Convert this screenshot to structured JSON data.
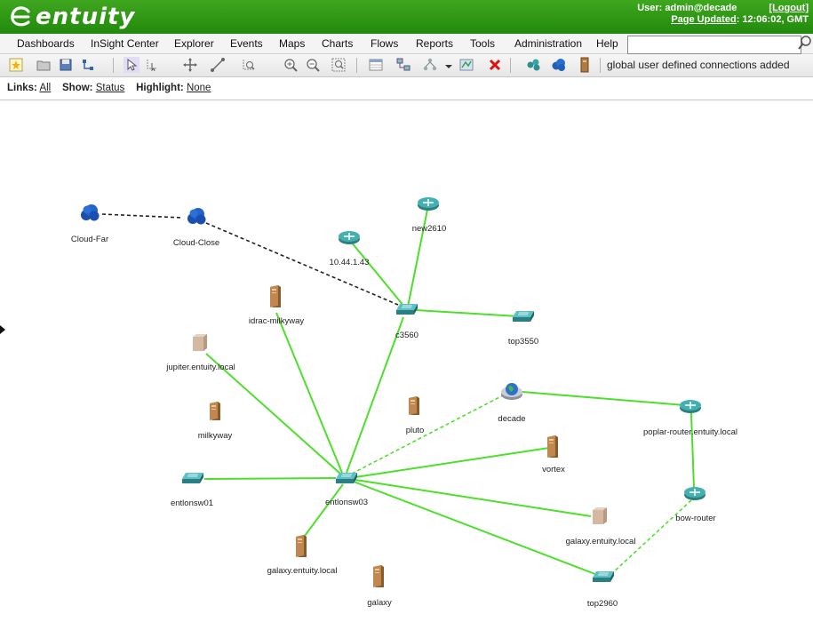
{
  "header": {
    "logo_text": "entuity",
    "user_label": "User: admin@decade",
    "logout_label": "[Logout]",
    "page_updated_link": "Page Updated",
    "page_updated_time": ": 12:06:02, GMT"
  },
  "menu": {
    "items": [
      "Dashboards",
      "InSight Center",
      "Explorer",
      "Events",
      "Maps",
      "Charts",
      "Flows",
      "Reports",
      "Tools",
      "Administration",
      "Help"
    ],
    "search_value": ""
  },
  "toolbar": {
    "status_text": "global user defined connections added",
    "icons": [
      "favorite-icon",
      "open-folder-icon",
      "save-icon",
      "layout-icon",
      "select-pointer-icon",
      "lasso-select-icon",
      "pan-icon",
      "connect-icon",
      "zoom-area-icon",
      "zoom-in-icon",
      "zoom-out-icon",
      "zoom-fit-icon",
      "table-view-icon",
      "network-devices-icon",
      "tree-layout-icon",
      "dropdown-arrow-icon",
      "map-icon",
      "delete-icon",
      "cloud-group-icon",
      "cloud-icon",
      "server-icon"
    ]
  },
  "filters": {
    "links_label": "Links:",
    "links_value": "All",
    "show_label": "Show:",
    "show_value": "Status",
    "highlight_label": "Highlight:",
    "highlight_value": "None"
  },
  "colors": {
    "header_green": "#2a9614",
    "link_up": "#4ce02a",
    "link_user_defined": "#222222",
    "router_teal": "#2e8f8f"
  },
  "map": {
    "nodes": [
      {
        "id": "cloud-far",
        "label": "Cloud-Far",
        "kind": "cloud"
      },
      {
        "id": "cloud-close",
        "label": "Cloud-Close",
        "kind": "cloud"
      },
      {
        "id": "new2610",
        "label": "new2610",
        "kind": "router"
      },
      {
        "id": "ip10",
        "label": "10.44.1.43",
        "kind": "router"
      },
      {
        "id": "c3560",
        "label": "c3560",
        "kind": "switch"
      },
      {
        "id": "top3550",
        "label": "top3550",
        "kind": "switch"
      },
      {
        "id": "idrac",
        "label": "idrac-milkyway",
        "kind": "server"
      },
      {
        "id": "jupiter",
        "label": "jupiter.entuity.local",
        "kind": "server-box"
      },
      {
        "id": "milkyway",
        "label": "milkyway",
        "kind": "server"
      },
      {
        "id": "pluto",
        "label": "pluto",
        "kind": "server"
      },
      {
        "id": "decade",
        "label": "decade",
        "kind": "globe"
      },
      {
        "id": "poplar",
        "label": "poplar-router.entuity.local",
        "kind": "router"
      },
      {
        "id": "vortex",
        "label": "vortex",
        "kind": "server"
      },
      {
        "id": "bow",
        "label": "bow-router",
        "kind": "router"
      },
      {
        "id": "entlonsw01",
        "label": "entlonsw01",
        "kind": "switch"
      },
      {
        "id": "entlonsw03",
        "label": "entlonsw03",
        "kind": "switch"
      },
      {
        "id": "galaxy-local-r",
        "label": "galaxy.entuity.local",
        "kind": "server-box"
      },
      {
        "id": "galaxy-local-l",
        "label": "galaxy.entuity.local",
        "kind": "server"
      },
      {
        "id": "galaxy",
        "label": "galaxy",
        "kind": "server"
      },
      {
        "id": "top2960",
        "label": "top2960",
        "kind": "switch"
      }
    ]
  }
}
